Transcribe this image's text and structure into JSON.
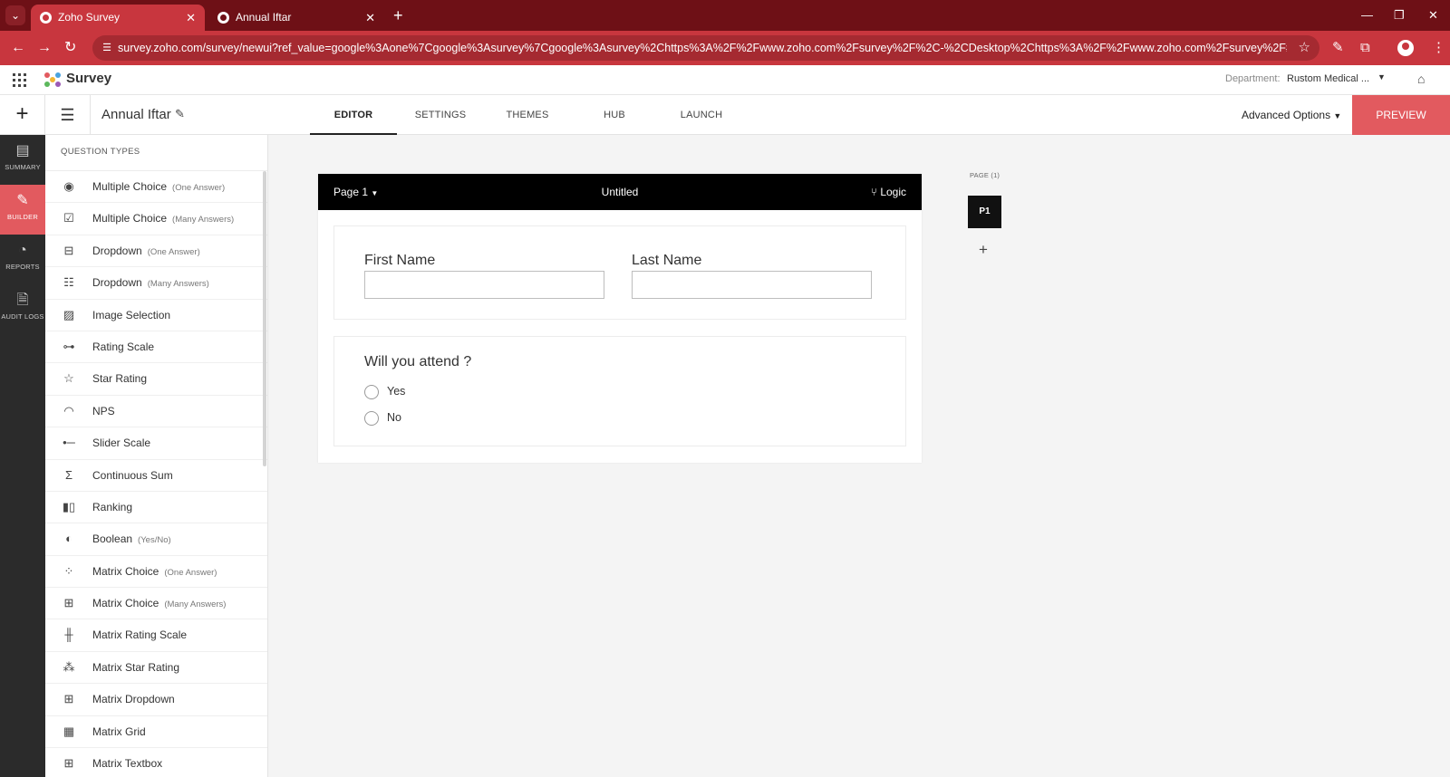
{
  "browser": {
    "tabs": [
      {
        "title": "Zoho Survey",
        "active": true
      },
      {
        "title": "Annual Iftar",
        "active": false
      }
    ],
    "url": "survey.zoho.com/survey/newui?ref_value=google%3Aone%7Cgoogle%3Asurvey%7Cgoogle%3Asurvey%2Chttps%3A%2F%2Fwww.zoho.com%2Fsurvey%2F%2C-%2CDesktop%2Chttps%3A%2F%2Fwww.zoho.com%2Fsurvey%2F#/portal/767887081/d..."
  },
  "app": {
    "name": "Survey",
    "department_label": "Department:",
    "department_value": "Rustom Medical ..."
  },
  "toolbar": {
    "survey_title": "Annual Iftar",
    "tabs": [
      "EDITOR",
      "SETTINGS",
      "THEMES",
      "HUB",
      "LAUNCH"
    ],
    "active_tab": "EDITOR",
    "advanced_options": "Advanced Options",
    "preview": "PREVIEW"
  },
  "rail": [
    {
      "label": "SUMMARY",
      "icon": "summary-icon",
      "active": false
    },
    {
      "label": "BUILDER",
      "icon": "pencil-icon",
      "active": true
    },
    {
      "label": "REPORTS",
      "icon": "pie-chart-icon",
      "active": false
    },
    {
      "label": "AUDIT LOGS",
      "icon": "audit-log-icon",
      "active": false
    }
  ],
  "question_types": {
    "heading": "QUESTION TYPES",
    "items": [
      {
        "label": "Multiple Choice",
        "sub": "(One Answer)",
        "icon": "radio-icon"
      },
      {
        "label": "Multiple Choice",
        "sub": "(Many Answers)",
        "icon": "checkbox-icon"
      },
      {
        "label": "Dropdown",
        "sub": "(One Answer)",
        "icon": "dropdown-icon"
      },
      {
        "label": "Dropdown",
        "sub": "(Many Answers)",
        "icon": "multi-dropdown-icon"
      },
      {
        "label": "Image Selection",
        "sub": "",
        "icon": "image-icon"
      },
      {
        "label": "Rating Scale",
        "sub": "",
        "icon": "rating-scale-icon"
      },
      {
        "label": "Star Rating",
        "sub": "",
        "icon": "star-icon"
      },
      {
        "label": "NPS",
        "sub": "",
        "icon": "gauge-icon"
      },
      {
        "label": "Slider Scale",
        "sub": "",
        "icon": "slider-icon"
      },
      {
        "label": "Continuous Sum",
        "sub": "",
        "icon": "sum-icon"
      },
      {
        "label": "Ranking",
        "sub": "",
        "icon": "ranking-icon"
      },
      {
        "label": "Boolean",
        "sub": "(Yes/No)",
        "icon": "toggle-icon"
      },
      {
        "label": "Matrix Choice",
        "sub": "(One Answer)",
        "icon": "matrix-radio-icon"
      },
      {
        "label": "Matrix Choice",
        "sub": "(Many Answers)",
        "icon": "matrix-checkbox-icon"
      },
      {
        "label": "Matrix Rating Scale",
        "sub": "",
        "icon": "matrix-rating-icon"
      },
      {
        "label": "Matrix Star Rating",
        "sub": "",
        "icon": "matrix-star-icon"
      },
      {
        "label": "Matrix Dropdown",
        "sub": "",
        "icon": "matrix-dropdown-icon"
      },
      {
        "label": "Matrix Grid",
        "sub": "",
        "icon": "grid-icon"
      },
      {
        "label": "Matrix Textbox",
        "sub": "",
        "icon": "matrix-textbox-icon"
      }
    ]
  },
  "canvas": {
    "page_selector": "Page 1",
    "page_name": "Untitled",
    "logic": "Logic",
    "name_fields": [
      {
        "label": "First Name",
        "value": ""
      },
      {
        "label": "Last Name",
        "value": ""
      }
    ],
    "question": {
      "title": "Will you attend ?",
      "options": [
        "Yes",
        "No"
      ]
    }
  },
  "pages_panel": {
    "label": "PAGE (1)",
    "pages": [
      "P1"
    ]
  },
  "colors": {
    "tabbar": "#6e1016",
    "addressbar": "#c8363e",
    "accent": "#e25a5f",
    "rail": "#2b2b2b"
  }
}
